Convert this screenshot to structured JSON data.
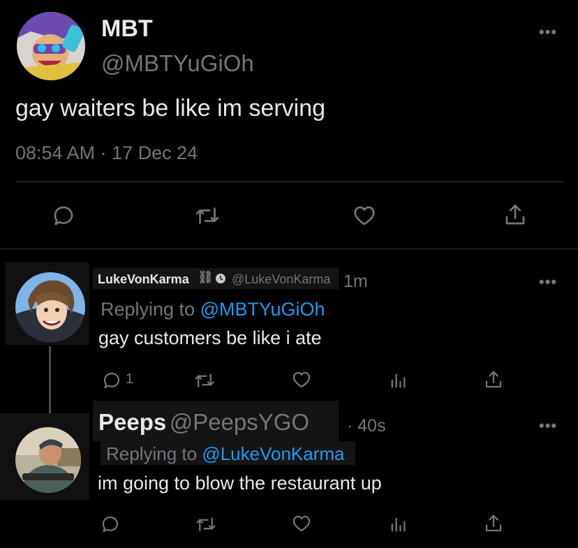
{
  "main_tweet": {
    "display_name": "MBT",
    "handle": "@MBTYuGiOh",
    "text": "gay waiters be like im serving",
    "time": "08:54 AM",
    "separator": "·",
    "date": "17 Dec 24",
    "more": "•••"
  },
  "reply1": {
    "display_name": "LukeVonKarma",
    "badges": "⛓",
    "handle": "@LukeVonKarma",
    "time": "1m",
    "replying_prefix": "Replying to ",
    "replying_handle": "@MBTYuGiOh",
    "text": "gay customers be like i ate",
    "reply_count": "1",
    "more": "•••"
  },
  "reply2": {
    "display_name": "Peeps",
    "handle": "@PeepsYGO",
    "separator": "·",
    "time": "40s",
    "replying_prefix": "Replying to ",
    "replying_handle": "@LukeVonKarma",
    "text": "im going to blow the restaurant up",
    "more": "•••"
  },
  "icons": {
    "reply": "reply-icon",
    "retweet": "retweet-icon",
    "like": "heart-icon",
    "views": "views-icon",
    "share": "share-icon"
  },
  "colors": {
    "background": "#000000",
    "text": "#e7e9ea",
    "muted": "#71767b",
    "link": "#1d9bf0",
    "divider": "#2f3336"
  }
}
